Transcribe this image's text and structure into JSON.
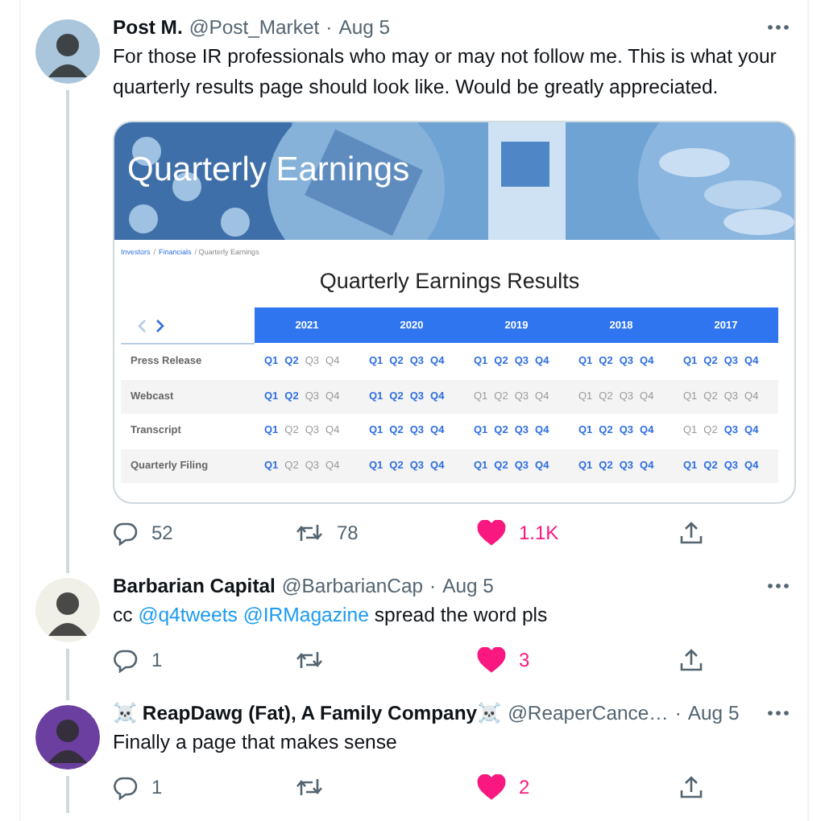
{
  "tweets": [
    {
      "author": "Post M.",
      "handle": "@Post_Market",
      "separator": "·",
      "date": "Aug 5",
      "text": [
        {
          "kind": "plain",
          "text": "For those IR professionals who may or may not follow me. This is what your quarterly results page should look like. Would be greatly appreciated."
        }
      ],
      "media": {
        "banner_title": "Quarterly Earnings",
        "breadcrumb": [
          {
            "kind": "link",
            "label": "Investors"
          },
          {
            "kind": "separator",
            "label": "/"
          },
          {
            "kind": "link",
            "label": "Financials"
          },
          {
            "kind": "current",
            "label": "/ Quarterly Earnings"
          }
        ],
        "title": "Quarterly Earnings Results",
        "pager": [
          {
            "kind": "prev",
            "disabled": true
          },
          {
            "kind": "next",
            "disabled": false
          }
        ],
        "years": [
          "2021",
          "2020",
          "2019",
          "2018",
          "2017"
        ],
        "rows": [
          {
            "label": "Press Release",
            "cells": [
              [
                {
                  "q": "Q1",
                  "available": true
                },
                {
                  "q": "Q2",
                  "available": true
                },
                {
                  "q": "Q3",
                  "available": false
                },
                {
                  "q": "Q4",
                  "available": false
                }
              ],
              [
                {
                  "q": "Q1",
                  "available": true
                },
                {
                  "q": "Q2",
                  "available": true
                },
                {
                  "q": "Q3",
                  "available": true
                },
                {
                  "q": "Q4",
                  "available": true
                }
              ],
              [
                {
                  "q": "Q1",
                  "available": true
                },
                {
                  "q": "Q2",
                  "available": true
                },
                {
                  "q": "Q3",
                  "available": true
                },
                {
                  "q": "Q4",
                  "available": true
                }
              ],
              [
                {
                  "q": "Q1",
                  "available": true
                },
                {
                  "q": "Q2",
                  "available": true
                },
                {
                  "q": "Q3",
                  "available": true
                },
                {
                  "q": "Q4",
                  "available": true
                }
              ],
              [
                {
                  "q": "Q1",
                  "available": true
                },
                {
                  "q": "Q2",
                  "available": true
                },
                {
                  "q": "Q3",
                  "available": true
                },
                {
                  "q": "Q4",
                  "available": true
                }
              ]
            ]
          },
          {
            "label": "Webcast",
            "cells": [
              [
                {
                  "q": "Q1",
                  "available": true
                },
                {
                  "q": "Q2",
                  "available": true
                },
                {
                  "q": "Q3",
                  "available": false
                },
                {
                  "q": "Q4",
                  "available": false
                }
              ],
              [
                {
                  "q": "Q1",
                  "available": true
                },
                {
                  "q": "Q2",
                  "available": true
                },
                {
                  "q": "Q3",
                  "available": true
                },
                {
                  "q": "Q4",
                  "available": true
                }
              ],
              [
                {
                  "q": "Q1",
                  "available": false
                },
                {
                  "q": "Q2",
                  "available": false
                },
                {
                  "q": "Q3",
                  "available": false
                },
                {
                  "q": "Q4",
                  "available": false
                }
              ],
              [
                {
                  "q": "Q1",
                  "available": false
                },
                {
                  "q": "Q2",
                  "available": false
                },
                {
                  "q": "Q3",
                  "available": false
                },
                {
                  "q": "Q4",
                  "available": false
                }
              ],
              [
                {
                  "q": "Q1",
                  "available": false
                },
                {
                  "q": "Q2",
                  "available": false
                },
                {
                  "q": "Q3",
                  "available": false
                },
                {
                  "q": "Q4",
                  "available": false
                }
              ]
            ]
          },
          {
            "label": "Transcript",
            "cells": [
              [
                {
                  "q": "Q1",
                  "available": true
                },
                {
                  "q": "Q2",
                  "available": false
                },
                {
                  "q": "Q3",
                  "available": false
                },
                {
                  "q": "Q4",
                  "available": false
                }
              ],
              [
                {
                  "q": "Q1",
                  "available": true
                },
                {
                  "q": "Q2",
                  "available": true
                },
                {
                  "q": "Q3",
                  "available": true
                },
                {
                  "q": "Q4",
                  "available": true
                }
              ],
              [
                {
                  "q": "Q1",
                  "available": true
                },
                {
                  "q": "Q2",
                  "available": true
                },
                {
                  "q": "Q3",
                  "available": true
                },
                {
                  "q": "Q4",
                  "available": true
                }
              ],
              [
                {
                  "q": "Q1",
                  "available": true
                },
                {
                  "q": "Q2",
                  "available": true
                },
                {
                  "q": "Q3",
                  "available": true
                },
                {
                  "q": "Q4",
                  "available": true
                }
              ],
              [
                {
                  "q": "Q1",
                  "available": false
                },
                {
                  "q": "Q2",
                  "available": false
                },
                {
                  "q": "Q3",
                  "available": true
                },
                {
                  "q": "Q4",
                  "available": true
                }
              ]
            ]
          },
          {
            "label": "Quarterly Filing",
            "cells": [
              [
                {
                  "q": "Q1",
                  "available": true
                },
                {
                  "q": "Q2",
                  "available": false
                },
                {
                  "q": "Q3",
                  "available": false
                },
                {
                  "q": "Q4",
                  "available": false
                }
              ],
              [
                {
                  "q": "Q1",
                  "available": true
                },
                {
                  "q": "Q2",
                  "available": true
                },
                {
                  "q": "Q3",
                  "available": true
                },
                {
                  "q": "Q4",
                  "available": true
                }
              ],
              [
                {
                  "q": "Q1",
                  "available": true
                },
                {
                  "q": "Q2",
                  "available": true
                },
                {
                  "q": "Q3",
                  "available": true
                },
                {
                  "q": "Q4",
                  "available": true
                }
              ],
              [
                {
                  "q": "Q1",
                  "available": true
                },
                {
                  "q": "Q2",
                  "available": true
                },
                {
                  "q": "Q3",
                  "available": true
                },
                {
                  "q": "Q4",
                  "available": true
                }
              ],
              [
                {
                  "q": "Q1",
                  "available": true
                },
                {
                  "q": "Q2",
                  "available": true
                },
                {
                  "q": "Q3",
                  "available": true
                },
                {
                  "q": "Q4",
                  "available": true
                }
              ]
            ]
          }
        ]
      },
      "stats": {
        "replies": "52",
        "retweets": "78",
        "likes": "1.1K",
        "liked": true
      }
    },
    {
      "author": "Barbarian Capital",
      "handle": "@BarbarianCap",
      "separator": "·",
      "date": "Aug 5",
      "text": [
        {
          "kind": "plain",
          "text": "cc "
        },
        {
          "kind": "mention",
          "text": "@q4tweets"
        },
        {
          "kind": "mention",
          "text": "@IRMagazine"
        },
        {
          "kind": "plain",
          "text": " spread the word pls"
        }
      ],
      "stats": {
        "replies": "1",
        "likes": "3",
        "liked": true
      }
    },
    {
      "author": "☠️ ReapDawg (Fat), A Family Company☠️",
      "handle": "@ReaperCance…",
      "separator": "·",
      "date": "Aug 5",
      "text": [
        {
          "kind": "plain",
          "text": "Finally a page that makes sense"
        }
      ],
      "stats": {
        "replies": "1",
        "likes": "2",
        "liked": true
      }
    }
  ]
}
